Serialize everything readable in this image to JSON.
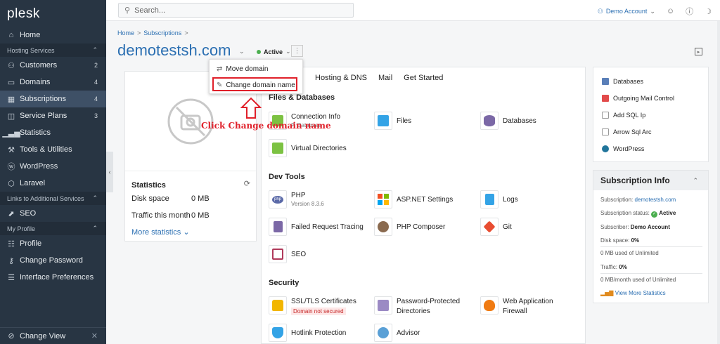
{
  "sidebar": {
    "logo": "plesk",
    "items": [
      {
        "key": "home",
        "label": "Home",
        "icon": "home-icon"
      },
      {
        "key": "group-hosting",
        "label": "Hosting Services",
        "group": true
      },
      {
        "key": "customers",
        "label": "Customers",
        "count": "2",
        "icon": "user-icon"
      },
      {
        "key": "domains",
        "label": "Domains",
        "count": "4",
        "icon": "monitor-icon"
      },
      {
        "key": "subscriptions",
        "label": "Subscriptions",
        "count": "4",
        "icon": "grid-icon",
        "active": true
      },
      {
        "key": "service-plans",
        "label": "Service Plans",
        "count": "3",
        "icon": "columns-icon"
      },
      {
        "key": "statistics",
        "label": "Statistics",
        "icon": "bar-chart-icon"
      },
      {
        "key": "tools",
        "label": "Tools & Utilities",
        "icon": "tools-icon"
      },
      {
        "key": "wordpress",
        "label": "WordPress",
        "icon": "wordpress-icon"
      },
      {
        "key": "laravel",
        "label": "Laravel",
        "icon": "laravel-icon"
      },
      {
        "key": "group-links",
        "label": "Links to Additional Services",
        "group": true
      },
      {
        "key": "seo",
        "label": "SEO",
        "icon": "trend-icon"
      },
      {
        "key": "group-profile",
        "label": "My Profile",
        "group": true
      },
      {
        "key": "profile",
        "label": "Profile",
        "icon": "id-card-icon"
      },
      {
        "key": "change-password",
        "label": "Change Password",
        "icon": "key-icon"
      },
      {
        "key": "interface-prefs",
        "label": "Interface Preferences",
        "icon": "list-icon"
      }
    ],
    "bottom": "Change View"
  },
  "topbar": {
    "search_placeholder": "Search...",
    "account": "Demo Account"
  },
  "breadcrumb": [
    "Home",
    "Subscriptions"
  ],
  "page": {
    "title": "demotestsh.com",
    "status": "Active"
  },
  "dropdown": {
    "move": "Move domain",
    "change": "Change domain name"
  },
  "annotation": "Click Change domain name",
  "statistics": {
    "title": "Statistics",
    "disk_label": "Disk space",
    "disk_value": "0 MB",
    "traffic_label": "Traffic this month",
    "traffic_value": "0 MB",
    "more": "More statistics"
  },
  "tabs": [
    "Hosting & DNS",
    "Mail",
    "Get Started"
  ],
  "sections": {
    "files": "Files & Databases",
    "dev": "Dev Tools",
    "security": "Security"
  },
  "tools": {
    "connection": {
      "label": "Connection Info",
      "sub": "P, Database"
    },
    "files": {
      "label": "Files"
    },
    "databases": {
      "label": "Databases"
    },
    "virtual": {
      "label": "Virtual Directories"
    },
    "php": {
      "label": "PHP",
      "sub": "Version 8.3.6"
    },
    "aspnet": {
      "label": "ASP.NET Settings"
    },
    "logs": {
      "label": "Logs"
    },
    "failed": {
      "label": "Failed Request Tracing"
    },
    "composer": {
      "label": "PHP Composer"
    },
    "git": {
      "label": "Git"
    },
    "seo": {
      "label": "SEO"
    },
    "ssl": {
      "label": "SSL/TLS Certificates",
      "warn": "Domain not secured"
    },
    "password": {
      "label": "Password-Protected",
      "label2": "Directories"
    },
    "waf": {
      "label": "Web Application",
      "label2": "Firewall"
    },
    "hotlink": {
      "label": "Hotlink Protection"
    },
    "advisor": {
      "label": "Advisor"
    }
  },
  "right_links": [
    "Databases",
    "Outgoing Mail Control",
    "Add SQL Ip",
    "Arrow Sql Arc",
    "WordPress"
  ],
  "subscription_info": {
    "title": "Subscription Info",
    "subscription_label": "Subscription:",
    "subscription_value": "demotestsh.com",
    "status_label": "Subscription status:",
    "status_value": "Active",
    "subscriber_label": "Subscriber:",
    "subscriber_value": "Demo Account",
    "disk_label": "Disk space:",
    "disk_value": "0%",
    "disk_used": "0 MB used of Unlimited",
    "traffic_label": "Traffic:",
    "traffic_value": "0%",
    "traffic_used": "0 MB/month used of Unlimited",
    "view_more": "View More Statistics"
  },
  "colors": {
    "accent": "#2b6fb2",
    "sidebar": "#283543",
    "annotation": "#e0202a",
    "active": "#4caf50"
  }
}
